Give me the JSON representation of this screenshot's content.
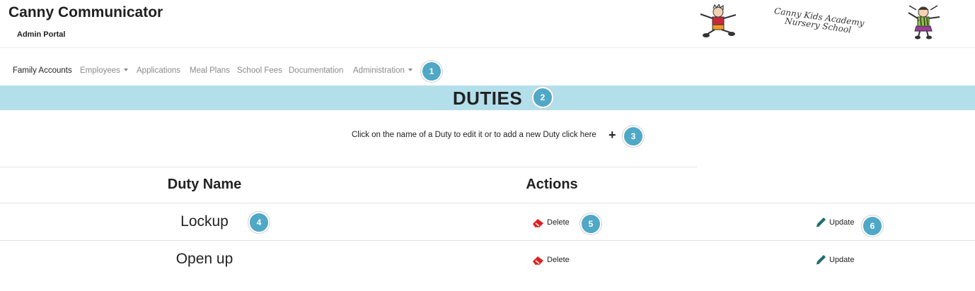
{
  "header": {
    "title": "Canny Communicator",
    "subtitle": "Admin Portal",
    "logo_line1": "Canny Kids Academy",
    "logo_line2": "Nursery School"
  },
  "nav": {
    "items": [
      {
        "label": "Family Accounts",
        "dropdown": false,
        "active": true
      },
      {
        "label": "Employees",
        "dropdown": true,
        "active": false
      },
      {
        "label": "Applications",
        "dropdown": false,
        "active": false
      },
      {
        "label": "Meal Plans",
        "dropdown": false,
        "active": false
      },
      {
        "label": "School Fees",
        "dropdown": false,
        "active": false
      },
      {
        "label": "Documentation",
        "dropdown": false,
        "active": false
      },
      {
        "label": "Administration",
        "dropdown": true,
        "active": false
      }
    ]
  },
  "page": {
    "title": "DUTIES",
    "instructions": "Click on the name of a Duty to edit it or to add a new Duty click here",
    "add_icon": "plus-icon"
  },
  "table": {
    "headers": [
      "Duty Name",
      "Actions"
    ],
    "rows": [
      {
        "name": "Lockup",
        "delete_label": "Delete",
        "update_label": "Update"
      },
      {
        "name": "Open up",
        "delete_label": "Delete",
        "update_label": "Update"
      }
    ]
  },
  "annotations": [
    "1",
    "2",
    "3",
    "4",
    "5",
    "6"
  ],
  "colors": {
    "banner": "#b3dfeb",
    "badge": "#4fa8c5",
    "delete_icon": "#e02020",
    "update_icon": "#1f6e6e",
    "nav_inactive": "#8a8a8a"
  }
}
